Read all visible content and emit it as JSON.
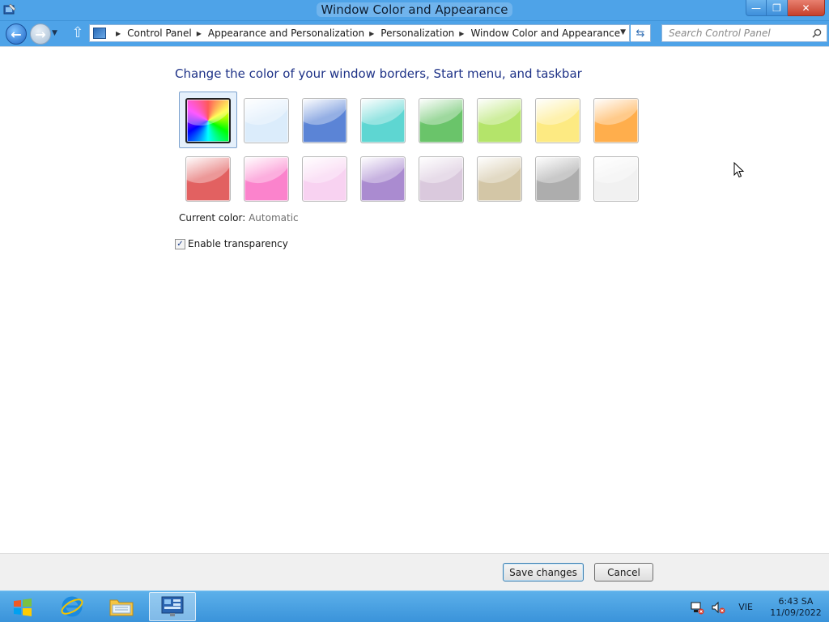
{
  "window": {
    "title": "Window Color and Appearance",
    "minimize": "—",
    "maximize": "❐",
    "close": "✕"
  },
  "nav": {
    "breadcrumb": [
      "Control Panel",
      "Appearance and Personalization",
      "Personalization",
      "Window Color and Appearance"
    ],
    "search_placeholder": "Search Control Panel"
  },
  "content": {
    "heading": "Change the color of your window borders, Start menu, and taskbar",
    "swatches": [
      {
        "id": "automatic",
        "color": "#ffffff"
      },
      {
        "id": "sky",
        "color": "#dbecfb"
      },
      {
        "id": "twilight",
        "color": "#5b84d6"
      },
      {
        "id": "sea-foam",
        "color": "#5ed6d2"
      },
      {
        "id": "leaf",
        "color": "#6ac46a"
      },
      {
        "id": "lime",
        "color": "#b4e46a"
      },
      {
        "id": "sun",
        "color": "#fdea82"
      },
      {
        "id": "pumpkin",
        "color": "#ffae4c"
      },
      {
        "id": "blush",
        "color": "#e26161"
      },
      {
        "id": "bubblegum",
        "color": "#fb83cc"
      },
      {
        "id": "violet",
        "color": "#f8d2f1"
      },
      {
        "id": "lavender",
        "color": "#aa8bd0"
      },
      {
        "id": "taupe",
        "color": "#dac9dd"
      },
      {
        "id": "chocolate",
        "color": "#d3c6a6"
      },
      {
        "id": "slate",
        "color": "#adadad"
      },
      {
        "id": "frost",
        "color": "#f1f1f1"
      }
    ],
    "current_color_label": "Current color:",
    "current_color_value": "Automatic",
    "transparency_label": "Enable transparency",
    "transparency_checked": true
  },
  "footer": {
    "save": "Save changes",
    "cancel": "Cancel"
  },
  "taskbar": {
    "language": "VIE",
    "time": "6:43 SA",
    "date": "11/09/2022"
  }
}
